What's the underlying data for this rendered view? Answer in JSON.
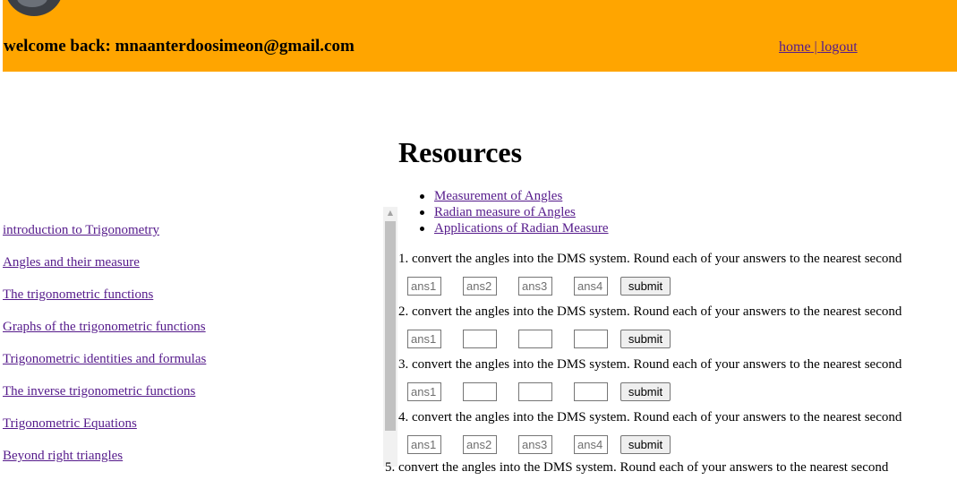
{
  "header": {
    "welcome_text": "welcome back: mnaanterdoosimeon@gmail.com",
    "nav": {
      "home": "home",
      "separator": " | ",
      "logout": "logout"
    },
    "background_color": "#ffa500"
  },
  "sidebar": {
    "links": [
      "introduction to Trigonometry",
      "Angles and their measure",
      "The trigonometric functions",
      "Graphs of the trigonometric functions",
      "Trigonometric identities and formulas",
      "The inverse trigonometric functions",
      "Trigonometric Equations",
      "Beyond right triangles"
    ]
  },
  "main": {
    "title": "Resources",
    "resources": [
      "Measurement of Angles",
      "Radian measure of Angles",
      "Applications of Radian Measure"
    ],
    "questions": [
      {
        "text": "1. convert the angles into the DMS system. Round each of your answers to the nearest second",
        "placeholders": [
          "ans1",
          "ans2",
          "ans3",
          "ans4"
        ],
        "submit": "submit"
      },
      {
        "text": "2. convert the angles into the DMS system. Round each of your answers to the nearest second",
        "placeholders": [
          "ans1",
          "",
          "",
          ""
        ],
        "submit": "submit"
      },
      {
        "text": "3. convert the angles into the DMS system. Round each of your answers to the nearest second",
        "placeholders": [
          "ans1",
          "",
          "",
          ""
        ],
        "submit": "submit"
      },
      {
        "text": "4. convert the angles into the DMS system. Round each of your answers to the nearest second",
        "placeholders": [
          "ans1",
          "ans2",
          "ans3",
          "ans4"
        ],
        "submit": "submit"
      }
    ],
    "partial_text": "5. convert the angles into the DMS system. Round each of your answers to the nearest second"
  },
  "colors": {
    "link": "#551a8b",
    "accent": "#ffa500"
  }
}
